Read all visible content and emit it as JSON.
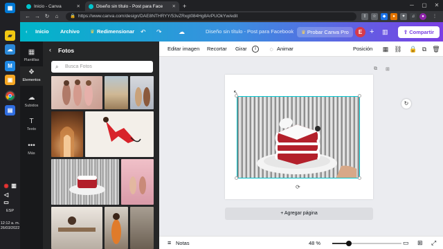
{
  "taskbar": {
    "clock_time": "12:12 a. m.",
    "clock_date": "26/03/2022",
    "language": "ESP",
    "icons": [
      "windows-store-icon",
      "sticky-notes-icon",
      "weather-icon",
      "mail-icon",
      "photos-icon",
      "chrome-icon",
      "files-icon"
    ]
  },
  "browser": {
    "tabs": [
      {
        "title": "Inicio - Canva",
        "active": false
      },
      {
        "title": "Diseño sin título - Post para Face",
        "active": true
      }
    ],
    "url": "https://www.canva.com/design/DAE8NTHRYY/53vZRxgt084Hg8ArPUOkYw/edit"
  },
  "canva_top": {
    "home": "Inicio",
    "file": "Archivo",
    "resize": "Redimensionar",
    "doc_title": "Diseño sin título - Post para Facebook",
    "try_pro": "Probar Canva Pro",
    "avatar_letter": "E",
    "share": "Compartir"
  },
  "rail": {
    "items": [
      {
        "label": "Plantillas",
        "icon": "templates-icon",
        "active": false
      },
      {
        "label": "Elementos",
        "icon": "elements-icon",
        "active": true
      },
      {
        "label": "Subidos",
        "icon": "upload-icon",
        "active": false
      },
      {
        "label": "Texto",
        "icon": "text-icon",
        "active": false
      },
      {
        "label": "Más",
        "icon": "more-icon",
        "active": false
      }
    ]
  },
  "panel": {
    "title": "Fotos",
    "search_placeholder": "Busca Fotos"
  },
  "toolbar": {
    "edit_image": "Editar imagen",
    "crop": "Recortar",
    "flip": "Girar",
    "animate": "Animar",
    "position": "Posición"
  },
  "editor": {
    "add_page": "+ Agregar página"
  },
  "footer": {
    "notes": "Notas",
    "zoom": "48 %",
    "zoom_level": 0.48
  },
  "colors": {
    "accent": "#00c4cc",
    "brand_purple": "#7b3fe4",
    "panel_bg": "#252627",
    "rail_bg": "#18191b"
  }
}
